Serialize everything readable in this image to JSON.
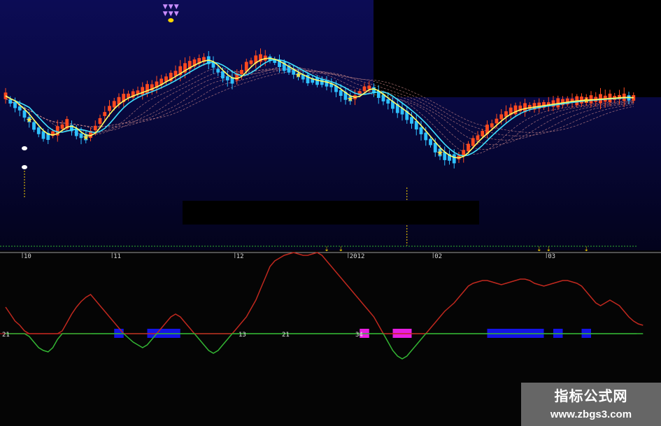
{
  "chart_data": [
    {
      "type": "candlestick",
      "title": "",
      "xlabel": "",
      "ylabel": "",
      "x_tick_labels": [
        "10",
        "11",
        "12",
        "2012",
        "02",
        "03"
      ],
      "grid": false,
      "colors": {
        "up": "#ff4a1f",
        "down": "#2ec0ff",
        "ma_short": "#ffff66",
        "ma_long": "#3fe0ff",
        "ribbon": "#d08c8c",
        "markers": "#ffe040"
      },
      "series": [
        {
          "values": [
            178,
            170,
            165,
            160,
            152,
            144,
            135,
            128,
            122,
            120,
            124,
            128,
            134,
            138,
            132,
            126,
            121,
            119,
            123,
            132,
            142,
            152,
            160,
            166,
            171,
            175,
            178,
            180,
            183,
            185,
            188,
            190,
            194,
            198,
            202,
            205,
            210,
            214,
            218,
            222,
            225,
            228,
            230,
            229,
            222,
            214,
            208,
            203,
            200,
            205,
            212,
            220,
            226,
            230,
            232,
            232,
            231,
            228,
            224,
            220,
            216,
            212,
            208,
            205,
            202,
            200,
            199,
            198,
            196,
            193,
            188,
            182,
            178,
            174,
            176,
            182,
            188,
            190,
            186,
            180,
            175,
            170,
            165,
            160,
            156,
            150,
            143,
            136,
            128,
            120,
            112,
            104,
            97,
            92,
            90,
            88,
            90,
            96,
            104,
            112,
            118,
            124,
            130,
            136,
            142,
            148,
            152,
            156,
            158,
            160,
            161,
            162,
            163,
            164,
            165,
            166,
            167,
            168,
            169,
            170,
            171,
            171,
            172,
            172,
            173,
            173,
            174,
            174,
            175,
            175,
            176,
            176,
            175,
            175
          ]
        },
        {
          "values": [
            19,
            14,
            9,
            6,
            2,
            -2,
            -6,
            -10,
            -12,
            -13,
            -10,
            -4,
            2,
            8,
            14,
            19,
            23,
            26,
            28,
            24,
            20,
            16,
            12,
            8,
            4,
            0,
            -3,
            -6,
            -8,
            -10,
            -8,
            -4,
            0,
            4,
            8,
            12,
            14,
            12,
            8,
            4,
            0,
            -4,
            -8,
            -12,
            -14,
            -12,
            -8,
            -4,
            0,
            4,
            8,
            12,
            18,
            24,
            32,
            40,
            48,
            52,
            54,
            56,
            57,
            58,
            57,
            56,
            56,
            57,
            58,
            56,
            52,
            48,
            44,
            40,
            36,
            32,
            28,
            24,
            20,
            16,
            12,
            6,
            0,
            -6,
            -12,
            -16,
            -18,
            -16,
            -12,
            -8,
            -4,
            0,
            4,
            8,
            12,
            16,
            19,
            22,
            26,
            30,
            34,
            36,
            37,
            38,
            38,
            37,
            36,
            35,
            36,
            37,
            38,
            39,
            39,
            38,
            36,
            35,
            34,
            35,
            36,
            37,
            38,
            38,
            37,
            36,
            34,
            30,
            26,
            22,
            20,
            22,
            24,
            22,
            20,
            16,
            12,
            9,
            7,
            6
          ]
        }
      ]
    }
  ],
  "indicator": {
    "name": "",
    "levels": [
      "21",
      "13",
      "21",
      "34"
    ]
  },
  "watermark": {
    "title": "指标公式网",
    "url": "www.zbgs3.com"
  }
}
